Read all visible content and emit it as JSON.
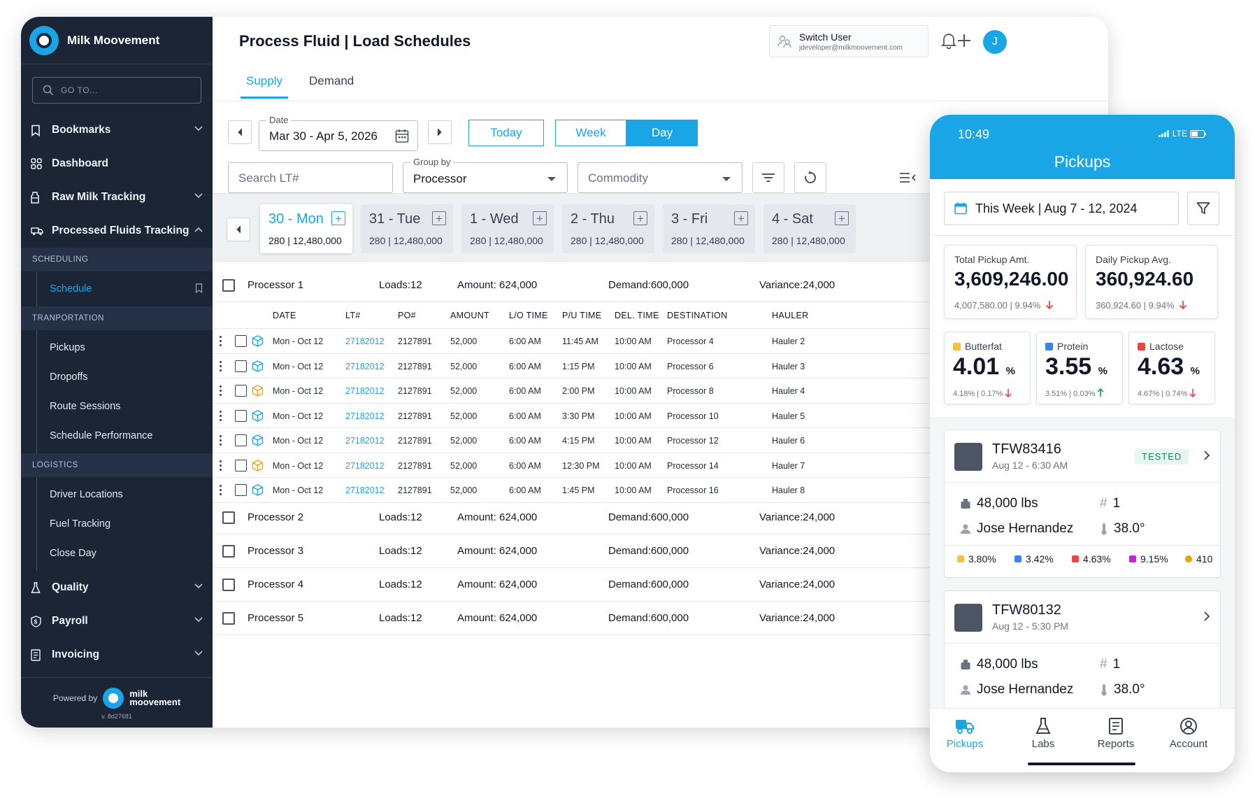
{
  "app": {
    "brand_name": "Milk Moovement",
    "accent": "#1aa5e6",
    "sidebar_bg": "#1b2536"
  },
  "sidebar": {
    "goto_placeholder": "GO TO...",
    "items": [
      {
        "label": "Bookmarks",
        "icon": "bookmark-icon",
        "expandable": true
      },
      {
        "label": "Dashboard",
        "icon": "dashboard-icon",
        "expandable": false
      },
      {
        "label": "Raw Milk Tracking",
        "icon": "milk-bottle-icon",
        "expandable": true
      },
      {
        "label": "Processed Fluids Tracking",
        "icon": "truck-icon",
        "expandable": true,
        "expanded": true
      }
    ],
    "sections": [
      {
        "label": "SCHEDULING",
        "items": [
          {
            "label": "Schedule",
            "active": true
          }
        ]
      },
      {
        "label": "TRANPORTATION",
        "items": [
          {
            "label": "Pickups"
          },
          {
            "label": "Dropoffs"
          },
          {
            "label": "Route Sessions"
          },
          {
            "label": "Schedule Performance"
          }
        ]
      },
      {
        "label": "LOGISTICS",
        "items": [
          {
            "label": "Driver Locations"
          },
          {
            "label": "Fuel Tracking"
          },
          {
            "label": "Close Day"
          }
        ]
      }
    ],
    "bottom_items": [
      {
        "label": "Quality",
        "icon": "flask-icon"
      },
      {
        "label": "Payroll",
        "icon": "dollar-shield-icon"
      },
      {
        "label": "Invoicing",
        "icon": "invoice-icon"
      }
    ],
    "powered_by": "Powered by",
    "powered_logo_line1": "milk",
    "powered_logo_line2": "moovement",
    "version": "v. 8d27681"
  },
  "header": {
    "title": "Process Fluid | Load Schedules",
    "switch_user_label": "Switch User",
    "switch_user_email": "jdeveloper@milkmoovement.com",
    "avatar_initial": "J"
  },
  "tabs": [
    {
      "label": "Supply",
      "active": true
    },
    {
      "label": "Demand",
      "active": false
    }
  ],
  "filters": {
    "date_label": "Date",
    "date_value": "Mar 30 - Apr 5, 2026",
    "today_label": "Today",
    "week_label": "Week",
    "day_label": "Day",
    "search_placeholder": "Search LT#",
    "group_by_label": "Group by",
    "group_by_value": "Processor",
    "commodity_placeholder": "Commodity"
  },
  "days": [
    {
      "label": "30 - Mon",
      "stat": "280 | 12,480,000",
      "active": true
    },
    {
      "label": "31 - Tue",
      "stat": "280 | 12,480,000"
    },
    {
      "label": "1 - Wed",
      "stat": "280 | 12,480,000"
    },
    {
      "label": "2 - Thu",
      "stat": "280 | 12,480,000"
    },
    {
      "label": "3 - Fri",
      "stat": "280 | 12,480,000"
    },
    {
      "label": "4 - Sat",
      "stat": "280 | 12,480,000"
    }
  ],
  "processors": [
    {
      "name": "Processor 1",
      "loads": "Loads:12",
      "amount": "Amount: 624,000",
      "demand": "Demand:600,000",
      "variance": "Variance:24,000"
    },
    {
      "name": "Processor 2",
      "loads": "Loads:12",
      "amount": "Amount: 624,000",
      "demand": "Demand:600,000",
      "variance": "Variance:24,000"
    },
    {
      "name": "Processor 3",
      "loads": "Loads:12",
      "amount": "Amount: 624,000",
      "demand": "Demand:600,000",
      "variance": "Variance:24,000"
    },
    {
      "name": "Processor 4",
      "loads": "Loads:12",
      "amount": "Amount: 624,000",
      "demand": "Demand:600,000",
      "variance": "Variance:24,000"
    },
    {
      "name": "Processor 5",
      "loads": "Loads:12",
      "amount": "Amount: 624,000",
      "demand": "Demand:600,000",
      "variance": "Variance:24,000"
    }
  ],
  "table": {
    "columns": [
      "DATE",
      "LT#",
      "PO#",
      "AMOUNT",
      "L/O TIME",
      "P/U TIME",
      "DEL. TIME",
      "DESTINATION",
      "HAULER"
    ],
    "rows": [
      {
        "date": "Mon - Oct 12",
        "lt": "27182012",
        "po": "2127891",
        "amount": "52,000",
        "lo": "6:00 AM",
        "pu": "11:45 AM",
        "del": "10:00 AM",
        "dest": "Processor 4",
        "hauler": "Hauler 2",
        "status_color": "#1aa5e6"
      },
      {
        "date": "Mon - Oct 12",
        "lt": "27182012",
        "po": "2127891",
        "amount": "52,000",
        "lo": "6:00 AM",
        "pu": "1:15 PM",
        "del": "10:00 AM",
        "dest": "Processor 6",
        "hauler": "Hauler 3",
        "status_color": "#1aa5e6"
      },
      {
        "date": "Mon - Oct 12",
        "lt": "27182012",
        "po": "2127891",
        "amount": "52,000",
        "lo": "6:00 AM",
        "pu": "2:00 PM",
        "del": "10:00 AM",
        "dest": "Processor 8",
        "hauler": "Hauler 4",
        "status_color": "#f59e0b"
      },
      {
        "date": "Mon - Oct 12",
        "lt": "27182012",
        "po": "2127891",
        "amount": "52,000",
        "lo": "6:00 AM",
        "pu": "3:30 PM",
        "del": "10:00 AM",
        "dest": "Processor 10",
        "hauler": "Hauler 5",
        "status_color": "#1aa5e6"
      },
      {
        "date": "Mon - Oct 12",
        "lt": "27182012",
        "po": "2127891",
        "amount": "52,000",
        "lo": "6:00 AM",
        "pu": "4:15 PM",
        "del": "10:00 AM",
        "dest": "Processor 12",
        "hauler": "Hauler 6",
        "status_color": "#1aa5e6"
      },
      {
        "date": "Mon - Oct 12",
        "lt": "27182012",
        "po": "2127891",
        "amount": "52,000",
        "lo": "6:00 AM",
        "pu": "12:30 PM",
        "del": "10:00 AM",
        "dest": "Processor 14",
        "hauler": "Hauler 7",
        "status_color": "#f59e0b"
      },
      {
        "date": "Mon - Oct 12",
        "lt": "27182012",
        "po": "2127891",
        "amount": "52,000",
        "lo": "6:00 AM",
        "pu": "1:45 PM",
        "del": "10:00 AM",
        "dest": "Processor 16",
        "hauler": "Hauler 8",
        "status_color": "#1aa5e6"
      }
    ]
  },
  "phone": {
    "time": "10:49",
    "network": "LTE",
    "title": "Pickups",
    "range": "This Week | Aug 7 - 12, 2024",
    "total": {
      "label": "Total Pickup Amt.",
      "value": "3,609,246.00",
      "sub": "4,007,580.00 | 9.94%"
    },
    "avg": {
      "label": "Daily Pickup Avg.",
      "value": "360,924.60",
      "sub": "360,924.60 | 9.94%"
    },
    "components": [
      {
        "label": "Butterfat",
        "value": "4.01",
        "unit": "%",
        "sub": "4.18% | 0.17%",
        "color": "#f5c242",
        "trend": "down"
      },
      {
        "label": "Protein",
        "value": "3.55",
        "unit": "%",
        "sub": "3.51% | 0.03%",
        "color": "#3b82f6",
        "trend": "up"
      },
      {
        "label": "Lactose",
        "value": "4.63",
        "unit": "%",
        "sub": "4.67% | 0.74%",
        "color": "#ef4444",
        "trend": "down"
      }
    ],
    "pickups": [
      {
        "id": "TFW83416",
        "date": "Aug 12 - 6:30 AM",
        "badge": "TESTED",
        "weight": "48,000 lbs",
        "count": "1",
        "driver": "Jose Hernandez",
        "temp": "38.0°",
        "comps": [
          "3.80%",
          "3.42%",
          "4.63%",
          "9.15%",
          "410"
        ]
      },
      {
        "id": "TFW80132",
        "date": "Aug 12 - 5:30 PM",
        "badge": "",
        "weight": "48,000 lbs",
        "count": "1",
        "driver": "Jose Hernandez",
        "temp": "38.0°"
      }
    ],
    "tabbar": [
      {
        "label": "Pickups",
        "active": true
      },
      {
        "label": "Labs"
      },
      {
        "label": "Reports"
      },
      {
        "label": "Account"
      }
    ]
  }
}
